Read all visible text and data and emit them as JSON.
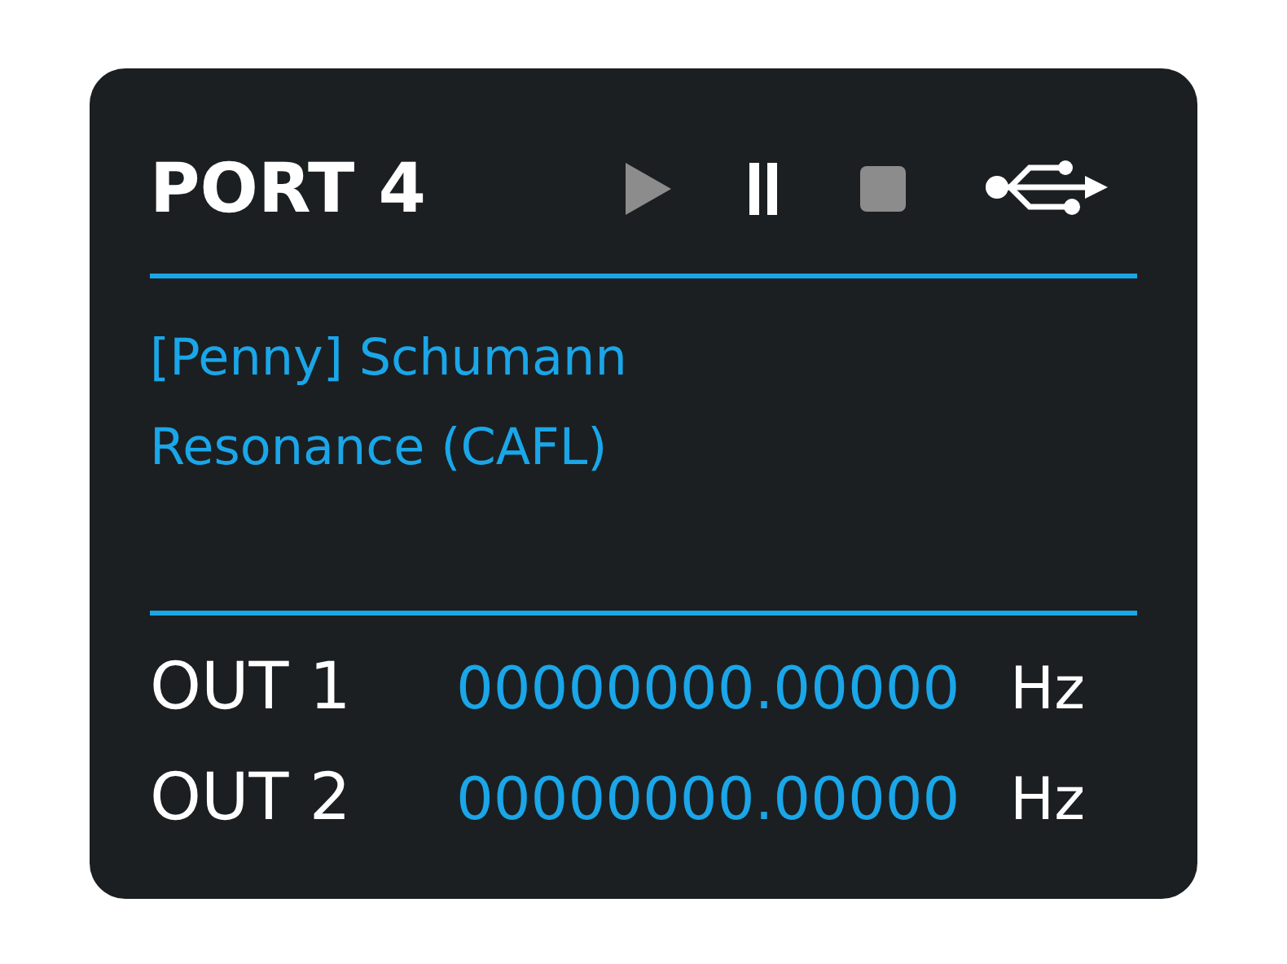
{
  "port": {
    "title": "PORT 4"
  },
  "controls": [
    {
      "kind": "play",
      "selected": false
    },
    {
      "kind": "pause",
      "selected": true
    },
    {
      "kind": "stop",
      "selected": false
    },
    {
      "kind": "usb",
      "selected": true
    }
  ],
  "program": {
    "name": "[Penny] Schumann Resonance (CAFL)"
  },
  "outputs": [
    {
      "label": "OUT 1",
      "value": "00000000.00000",
      "unit": "Hz"
    },
    {
      "label": "OUT 2",
      "value": "00000000.00000",
      "unit": "Hz"
    }
  ]
}
